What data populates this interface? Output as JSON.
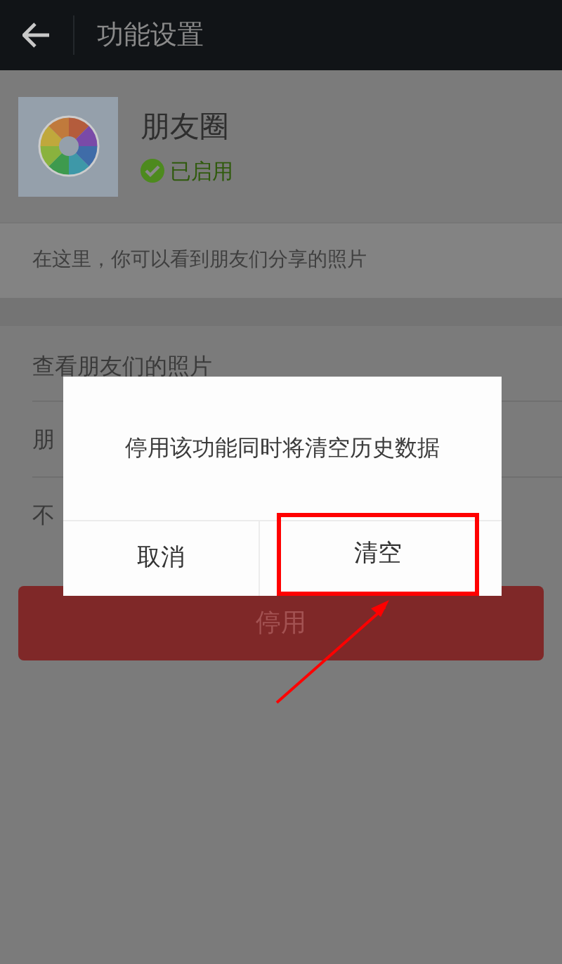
{
  "header": {
    "title": "功能设置"
  },
  "app": {
    "name": "朋友圈",
    "status": "已启用",
    "enabled": true
  },
  "description": "在这里，你可以看到朋友们分享的照片",
  "options": [
    {
      "label": "查看朋友们的照片"
    },
    {
      "label": "朋"
    },
    {
      "label": "不"
    }
  ],
  "disable_button": "停用",
  "dialog": {
    "message": "停用该功能同时将清空历史数据",
    "buttons": [
      {
        "label": "取消",
        "highlighted": false
      },
      {
        "label": "清空",
        "highlighted": true
      }
    ]
  }
}
